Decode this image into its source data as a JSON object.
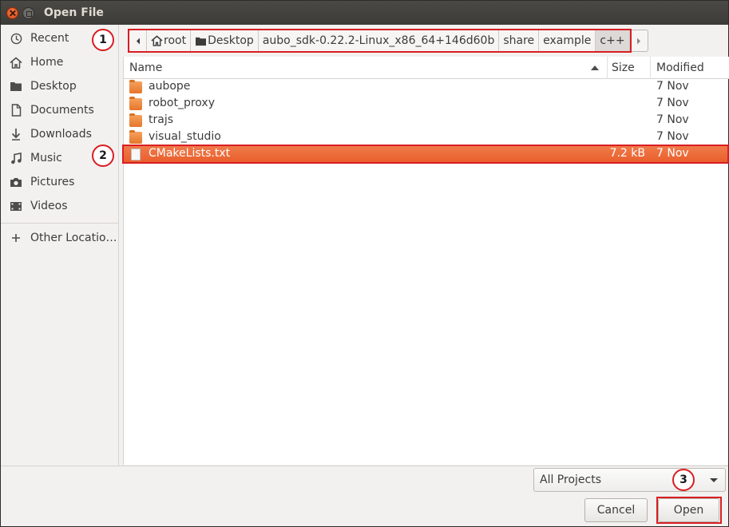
{
  "window": {
    "title": "Open File"
  },
  "sidebar": {
    "items": [
      {
        "label": "Recent",
        "icon": "clock-icon"
      },
      {
        "label": "Home",
        "icon": "home-icon"
      },
      {
        "label": "Desktop",
        "icon": "desktop-folder-icon"
      },
      {
        "label": "Documents",
        "icon": "document-icon"
      },
      {
        "label": "Downloads",
        "icon": "download-icon"
      },
      {
        "label": "Music",
        "icon": "music-icon"
      },
      {
        "label": "Pictures",
        "icon": "camera-icon"
      },
      {
        "label": "Videos",
        "icon": "video-icon"
      }
    ],
    "other": {
      "label": "Other Locatio…",
      "icon": "plus-icon"
    }
  },
  "pathbar": {
    "crumbs": [
      "root",
      "Desktop",
      "aubo_sdk-0.22.2-Linux_x86_64+146d60b",
      "share",
      "example",
      "c++"
    ]
  },
  "filelist": {
    "headers": {
      "name": "Name",
      "size": "Size",
      "modified": "Modified"
    },
    "rows": [
      {
        "name": "aubope",
        "size": "",
        "modified": "7 Nov",
        "type": "folder"
      },
      {
        "name": "robot_proxy",
        "size": "",
        "modified": "7 Nov",
        "type": "folder"
      },
      {
        "name": "trajs",
        "size": "",
        "modified": "7 Nov",
        "type": "folder"
      },
      {
        "name": "visual_studio",
        "size": "",
        "modified": "7 Nov",
        "type": "folder"
      },
      {
        "name": "CMakeLists.txt",
        "size": "7.2 kB",
        "modified": "7 Nov",
        "type": "file",
        "selected": true
      }
    ]
  },
  "filter": {
    "selected": "All Projects"
  },
  "buttons": {
    "cancel": "Cancel",
    "open": "Open"
  },
  "annotations": [
    "1",
    "2",
    "3"
  ],
  "colors": {
    "accent": "#e95e2b",
    "annotation": "#d81e22"
  }
}
